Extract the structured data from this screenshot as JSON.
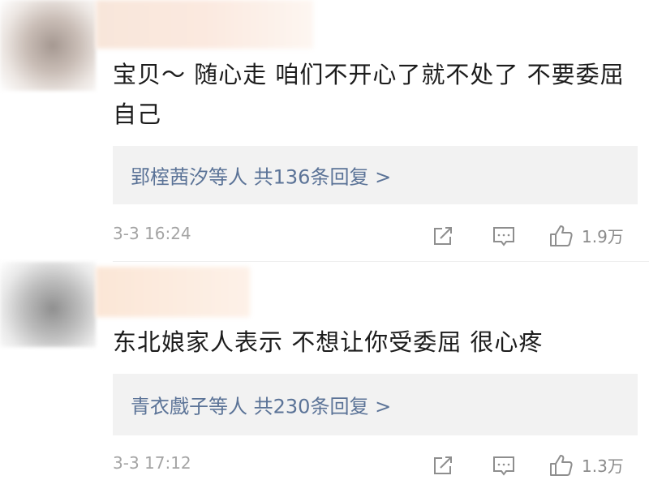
{
  "comments": [
    {
      "text": "宝贝～ 随心走 咱们不开心了就不处了 不要委屈自己",
      "reply_names": "郢榁茜汐等人",
      "reply_count": "共136条回复 >",
      "timestamp": "3-3 16:24",
      "likes": "1.9万"
    },
    {
      "text": "东北娘家人表示  不想让你受委屈  很心疼",
      "reply_names": "青衣戲子等人",
      "reply_count": "共230条回复 >",
      "timestamp": "3-3 17:12",
      "likes": "1.3万"
    }
  ],
  "icons": {
    "share": "share-icon",
    "comment": "comment-icon",
    "like": "thumbs-up-icon"
  },
  "colors": {
    "link": "#5b7397",
    "meta": "#a4a4a4",
    "reply_bg": "#f2f2f2"
  }
}
